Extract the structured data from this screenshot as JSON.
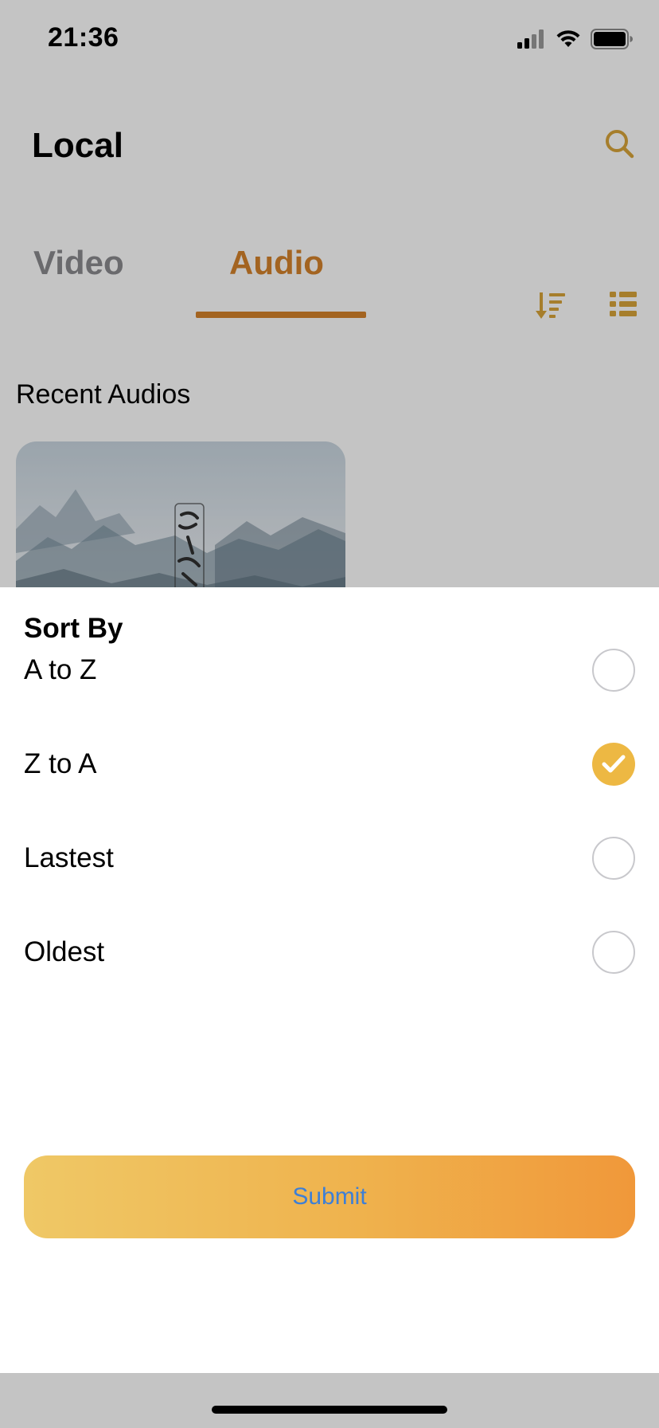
{
  "status_bar": {
    "time": "21:36"
  },
  "header": {
    "title": "Local",
    "search_icon": "search-icon"
  },
  "tabs": [
    {
      "label": "Video",
      "active": false
    },
    {
      "label": "Audio",
      "active": true
    }
  ],
  "toolbar": {
    "sort_icon": "sort-descending-icon",
    "view_icon": "list-view-icon"
  },
  "recent": {
    "title": "Recent Audios"
  },
  "sort_sheet": {
    "title": "Sort By",
    "options": [
      {
        "label": "A to Z",
        "selected": false
      },
      {
        "label": "Z to A",
        "selected": true
      },
      {
        "label": "Lastest",
        "selected": false
      },
      {
        "label": "Oldest",
        "selected": false
      }
    ],
    "submit_label": "Submit"
  },
  "colors": {
    "accent": "#d4822b",
    "icon": "#d9a53a",
    "radio_selected": "#edb843",
    "submit_gradient_start": "#efc866",
    "submit_gradient_end": "#f0983a",
    "submit_text": "#3d7fd6"
  }
}
